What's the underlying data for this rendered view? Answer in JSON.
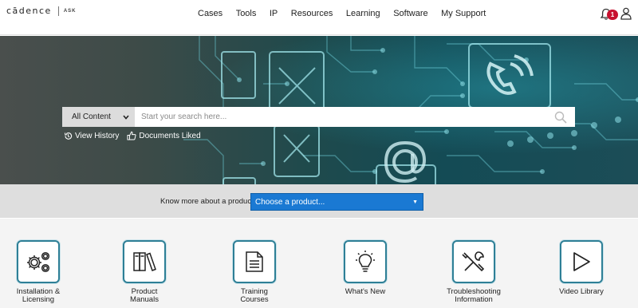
{
  "header": {
    "logo_word": "cādence",
    "logo_sub": "ASK",
    "nav": [
      "Cases",
      "Tools",
      "IP",
      "Resources",
      "Learning",
      "Software",
      "My Support"
    ],
    "notification_count": "1"
  },
  "search": {
    "scope_selected": "All Content",
    "placeholder": "Start your search here...",
    "links": [
      "View History",
      "Documents Liked"
    ]
  },
  "product": {
    "label": "Know more about a product:",
    "selected": "Choose a product..."
  },
  "tiles": [
    {
      "label": "Installation &\nLicensing",
      "icon": "gears-icon"
    },
    {
      "label": "Product\nManuals",
      "icon": "books-icon"
    },
    {
      "label": "Training\nCourses",
      "icon": "document-icon"
    },
    {
      "label": "What's New",
      "icon": "lightbulb-icon"
    },
    {
      "label": "Troubleshooting\nInformation",
      "icon": "tools-icon"
    },
    {
      "label": "Video Library",
      "icon": "play-icon"
    }
  ],
  "colors": {
    "accent": "#1a79d3",
    "tile_border": "#2e7f96",
    "badge": "#c8102e"
  }
}
